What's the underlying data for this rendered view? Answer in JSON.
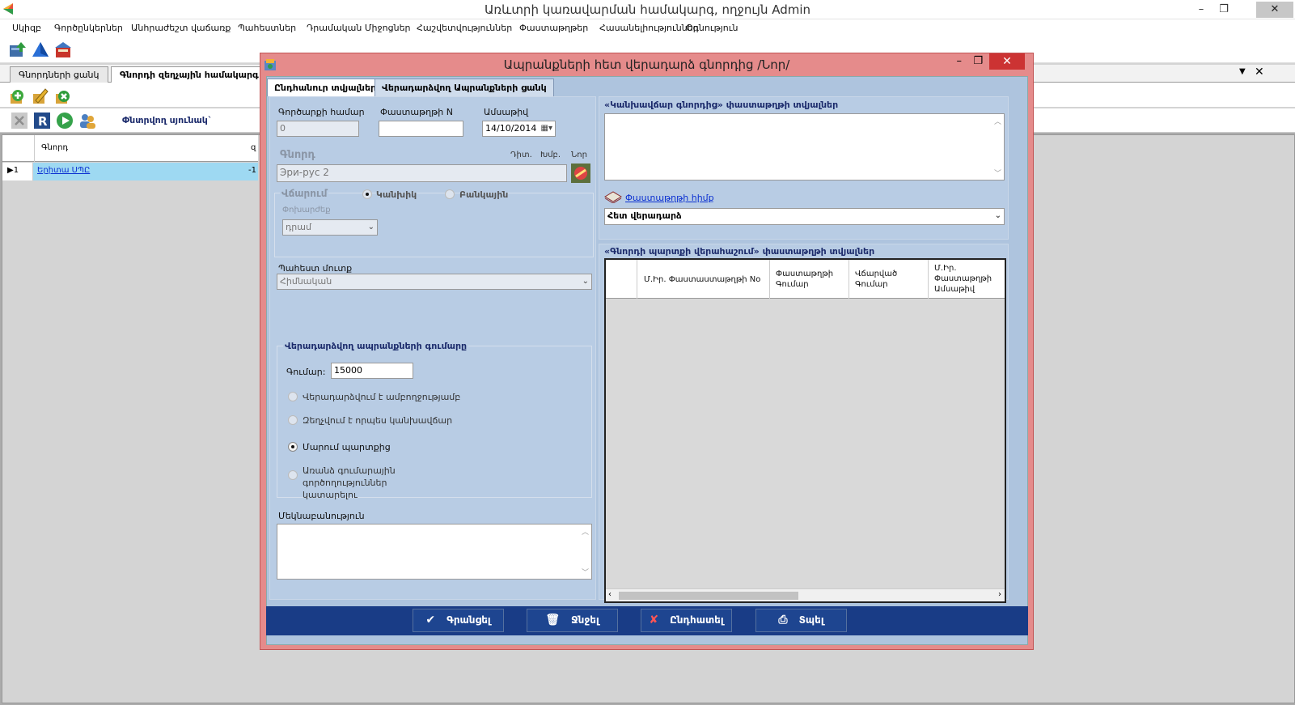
{
  "app": {
    "title": "Առևտրի կառավարման համակարգ, ողջույն Admin",
    "min_label": "–",
    "max_label": "❐",
    "close_label": "✕"
  },
  "menu": [
    "Սկիզբ",
    "Գործընկերներ",
    "Անհրաժեշտ վաճառք",
    "Պահեստներ",
    "Դրամական Միջոցներ",
    "Հաշվետվություններ",
    "Փաստաթղթեր",
    "Հասանելիություններ",
    "Օգնություն"
  ],
  "doc_tabs": [
    "Գնորդների ցանկ",
    "Գնորդի զեղչային համակարգ"
  ],
  "toolbar3": {
    "filter_label": "Փնտրվող սյունակ`"
  },
  "grid": {
    "headers": [
      "Գնորդ",
      "զ"
    ],
    "row_indicator": "▶1",
    "rows": [
      {
        "name": "Երիտա ՍՊԸ",
        "value": "-1"
      }
    ]
  },
  "dialog": {
    "title": "Ապրանքների հետ վերադարձ գնորդից /Նոր/",
    "min_label": "–",
    "max_label": "❐",
    "close_label": "✕",
    "tabs": [
      "Ընդհանուր տվյալներ",
      "Վերադարձվող Ապրանքների ցանկ"
    ],
    "general": {
      "deal_no_label": "Գործարքի համար",
      "deal_no_value": "0",
      "doc_no_label": "Փաստաթղթի N",
      "doc_no_value": "",
      "date_label": "Ամսաթիվ",
      "date_value": "14/10/2014",
      "buyer_label": "Գնորդ",
      "buyer_flags": [
        "Դիտ.",
        "Խմբ.",
        "Նոր"
      ],
      "buyer_value": "Эри-рус 2",
      "payment_label": "Վճարում",
      "payment_options": [
        "Կանխիկ",
        "Բանկային"
      ],
      "currency_label": "Փոխարժեք",
      "currency_value": "դրամ",
      "warehouse_label": "Պահեստ մուտք",
      "warehouse_value": "Հիմնական"
    },
    "returned_sum": {
      "group_label": "Վերադարձվող ապրանքների գումարը",
      "amount_label": "Գումար:",
      "amount_value": "15000",
      "options": [
        "Վերադարձվում է ամբողջությամբ",
        "Զեղչվում է որպես կանխավճար",
        "Մարում պարտքից",
        "Առանձ գումարային գործողություններ կատարելու"
      ],
      "selected_index": 2
    },
    "comment_label": "Մեկնաբանություն",
    "right": {
      "cash_order_group": "«Կանխավճար գնորդից» փաստաթղթի տվյալներ",
      "doc_basis_label": "Փաստաթղթի հիմք",
      "doc_basis_value": "Հետ վերադարձ",
      "debt_group": "«Գնորդի պարտքի վերահաշում» փաստաթղթի տվյալներ",
      "columns": [
        "Մ.Իր. Փաստաստաթղթի No",
        "Փաստաթղթի Գումար",
        "Վճարված Գումար",
        "Մ.Իր. Փաստաթղթի Ամսաթիվ"
      ]
    },
    "buttons": {
      "save": "Գրանցել",
      "delete": "Ջնջել",
      "cancel": "Ընդհատել",
      "print": "Տպել"
    }
  },
  "colors": {
    "dialog_frame": "#e58b8b",
    "dialog_body": "#aec4de",
    "button_bar": "#193c86",
    "selected_row": "#9ed9f2",
    "close_red": "#cc3333"
  }
}
